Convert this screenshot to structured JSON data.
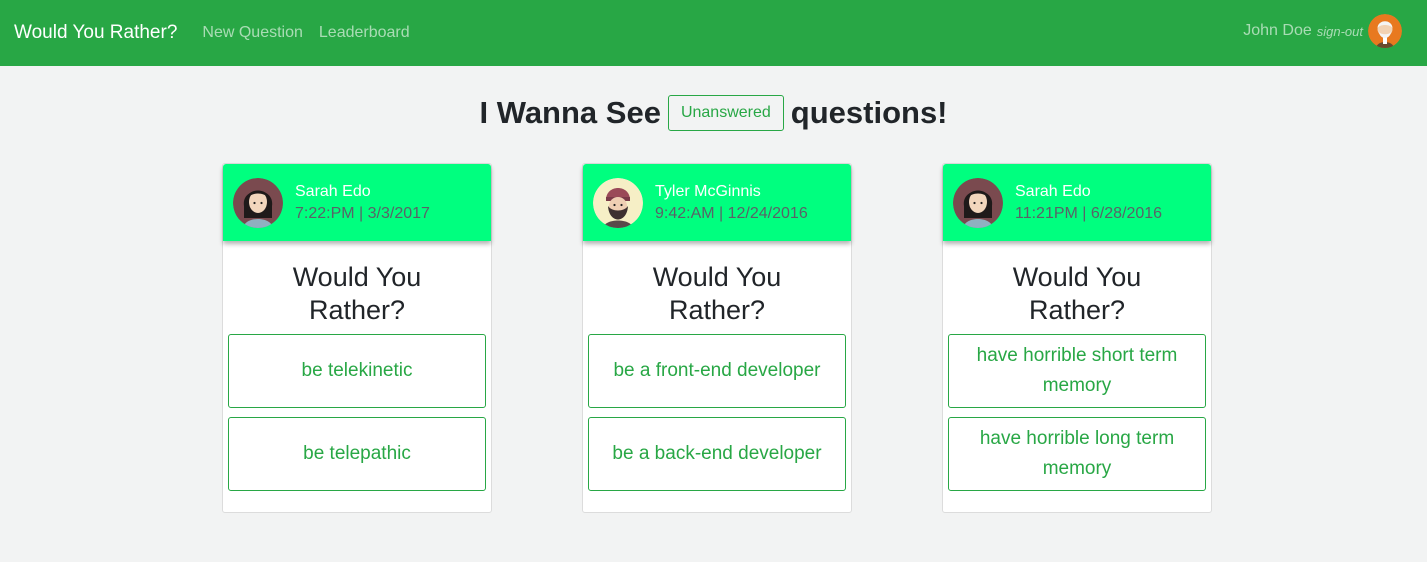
{
  "nav": {
    "brand": "Would You Rather?",
    "new_question": "New Question",
    "leaderboard": "Leaderboard",
    "user_name": "John Doe",
    "sign_out": "sign-out"
  },
  "heading": {
    "prefix": "I Wanna See",
    "filter": "Unanswered",
    "suffix": "questions!"
  },
  "cards": [
    {
      "author": "Sarah Edo",
      "timestamp": "7:22:PM | 3/3/2017",
      "title": "Would You Rather?",
      "option_one": "be telekinetic",
      "option_two": "be telepathic"
    },
    {
      "author": "Tyler McGinnis",
      "timestamp": "9:42:AM | 12/24/2016",
      "title": "Would You Rather?",
      "option_one": "be a front-end developer",
      "option_two": "be a back-end developer"
    },
    {
      "author": "Sarah Edo",
      "timestamp": "11:21PM | 6/28/2016",
      "title": "Would You Rather?",
      "option_one": "have horrible short term memory",
      "option_two": "have horrible long term memory"
    }
  ],
  "colors": {
    "navbar": "#28a745",
    "card_header": "#00ff7f",
    "accent": "#28a745"
  }
}
